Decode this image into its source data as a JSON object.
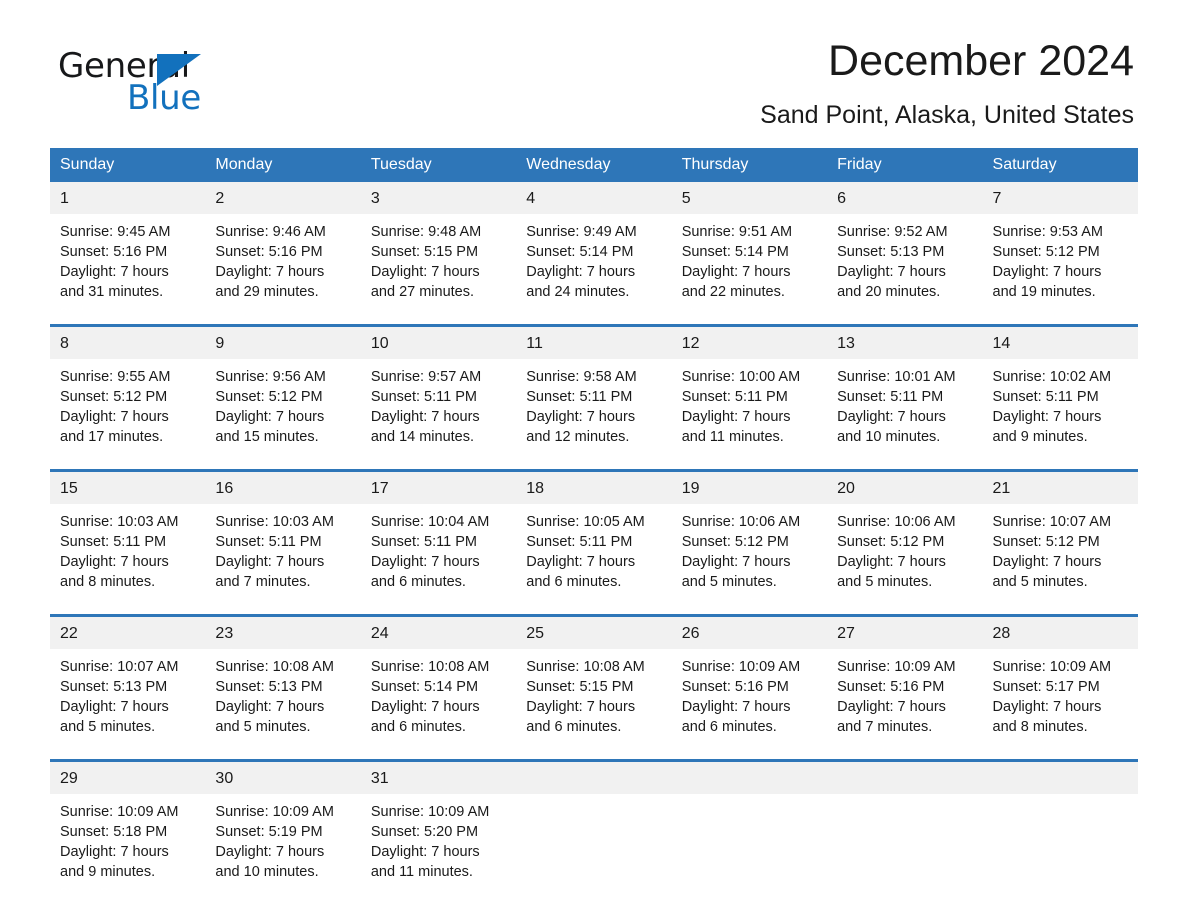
{
  "logo": {
    "word_one": "General",
    "word_two": "Blue",
    "triangle": "triangle-mark"
  },
  "header": {
    "title": "December 2024",
    "location": "Sand Point, Alaska, United States"
  },
  "calendar": {
    "day_headers": [
      "Sunday",
      "Monday",
      "Tuesday",
      "Wednesday",
      "Thursday",
      "Friday",
      "Saturday"
    ],
    "colors": {
      "header_blue": "#2e76b8",
      "daynum_band": "#f1f1f1",
      "logo_blue": "#1271bd",
      "text": "#1a1a1a"
    },
    "weeks": [
      [
        {
          "day": "1",
          "sunrise": "Sunrise: 9:45 AM",
          "sunset": "Sunset: 5:16 PM",
          "daylight1": "Daylight: 7 hours",
          "daylight2": "and 31 minutes."
        },
        {
          "day": "2",
          "sunrise": "Sunrise: 9:46 AM",
          "sunset": "Sunset: 5:16 PM",
          "daylight1": "Daylight: 7 hours",
          "daylight2": "and 29 minutes."
        },
        {
          "day": "3",
          "sunrise": "Sunrise: 9:48 AM",
          "sunset": "Sunset: 5:15 PM",
          "daylight1": "Daylight: 7 hours",
          "daylight2": "and 27 minutes."
        },
        {
          "day": "4",
          "sunrise": "Sunrise: 9:49 AM",
          "sunset": "Sunset: 5:14 PM",
          "daylight1": "Daylight: 7 hours",
          "daylight2": "and 24 minutes."
        },
        {
          "day": "5",
          "sunrise": "Sunrise: 9:51 AM",
          "sunset": "Sunset: 5:14 PM",
          "daylight1": "Daylight: 7 hours",
          "daylight2": "and 22 minutes."
        },
        {
          "day": "6",
          "sunrise": "Sunrise: 9:52 AM",
          "sunset": "Sunset: 5:13 PM",
          "daylight1": "Daylight: 7 hours",
          "daylight2": "and 20 minutes."
        },
        {
          "day": "7",
          "sunrise": "Sunrise: 9:53 AM",
          "sunset": "Sunset: 5:12 PM",
          "daylight1": "Daylight: 7 hours",
          "daylight2": "and 19 minutes."
        }
      ],
      [
        {
          "day": "8",
          "sunrise": "Sunrise: 9:55 AM",
          "sunset": "Sunset: 5:12 PM",
          "daylight1": "Daylight: 7 hours",
          "daylight2": "and 17 minutes."
        },
        {
          "day": "9",
          "sunrise": "Sunrise: 9:56 AM",
          "sunset": "Sunset: 5:12 PM",
          "daylight1": "Daylight: 7 hours",
          "daylight2": "and 15 minutes."
        },
        {
          "day": "10",
          "sunrise": "Sunrise: 9:57 AM",
          "sunset": "Sunset: 5:11 PM",
          "daylight1": "Daylight: 7 hours",
          "daylight2": "and 14 minutes."
        },
        {
          "day": "11",
          "sunrise": "Sunrise: 9:58 AM",
          "sunset": "Sunset: 5:11 PM",
          "daylight1": "Daylight: 7 hours",
          "daylight2": "and 12 minutes."
        },
        {
          "day": "12",
          "sunrise": "Sunrise: 10:00 AM",
          "sunset": "Sunset: 5:11 PM",
          "daylight1": "Daylight: 7 hours",
          "daylight2": "and 11 minutes."
        },
        {
          "day": "13",
          "sunrise": "Sunrise: 10:01 AM",
          "sunset": "Sunset: 5:11 PM",
          "daylight1": "Daylight: 7 hours",
          "daylight2": "and 10 minutes."
        },
        {
          "day": "14",
          "sunrise": "Sunrise: 10:02 AM",
          "sunset": "Sunset: 5:11 PM",
          "daylight1": "Daylight: 7 hours",
          "daylight2": "and 9 minutes."
        }
      ],
      [
        {
          "day": "15",
          "sunrise": "Sunrise: 10:03 AM",
          "sunset": "Sunset: 5:11 PM",
          "daylight1": "Daylight: 7 hours",
          "daylight2": "and 8 minutes."
        },
        {
          "day": "16",
          "sunrise": "Sunrise: 10:03 AM",
          "sunset": "Sunset: 5:11 PM",
          "daylight1": "Daylight: 7 hours",
          "daylight2": "and 7 minutes."
        },
        {
          "day": "17",
          "sunrise": "Sunrise: 10:04 AM",
          "sunset": "Sunset: 5:11 PM",
          "daylight1": "Daylight: 7 hours",
          "daylight2": "and 6 minutes."
        },
        {
          "day": "18",
          "sunrise": "Sunrise: 10:05 AM",
          "sunset": "Sunset: 5:11 PM",
          "daylight1": "Daylight: 7 hours",
          "daylight2": "and 6 minutes."
        },
        {
          "day": "19",
          "sunrise": "Sunrise: 10:06 AM",
          "sunset": "Sunset: 5:12 PM",
          "daylight1": "Daylight: 7 hours",
          "daylight2": "and 5 minutes."
        },
        {
          "day": "20",
          "sunrise": "Sunrise: 10:06 AM",
          "sunset": "Sunset: 5:12 PM",
          "daylight1": "Daylight: 7 hours",
          "daylight2": "and 5 minutes."
        },
        {
          "day": "21",
          "sunrise": "Sunrise: 10:07 AM",
          "sunset": "Sunset: 5:12 PM",
          "daylight1": "Daylight: 7 hours",
          "daylight2": "and 5 minutes."
        }
      ],
      [
        {
          "day": "22",
          "sunrise": "Sunrise: 10:07 AM",
          "sunset": "Sunset: 5:13 PM",
          "daylight1": "Daylight: 7 hours",
          "daylight2": "and 5 minutes."
        },
        {
          "day": "23",
          "sunrise": "Sunrise: 10:08 AM",
          "sunset": "Sunset: 5:13 PM",
          "daylight1": "Daylight: 7 hours",
          "daylight2": "and 5 minutes."
        },
        {
          "day": "24",
          "sunrise": "Sunrise: 10:08 AM",
          "sunset": "Sunset: 5:14 PM",
          "daylight1": "Daylight: 7 hours",
          "daylight2": "and 6 minutes."
        },
        {
          "day": "25",
          "sunrise": "Sunrise: 10:08 AM",
          "sunset": "Sunset: 5:15 PM",
          "daylight1": "Daylight: 7 hours",
          "daylight2": "and 6 minutes."
        },
        {
          "day": "26",
          "sunrise": "Sunrise: 10:09 AM",
          "sunset": "Sunset: 5:16 PM",
          "daylight1": "Daylight: 7 hours",
          "daylight2": "and 6 minutes."
        },
        {
          "day": "27",
          "sunrise": "Sunrise: 10:09 AM",
          "sunset": "Sunset: 5:16 PM",
          "daylight1": "Daylight: 7 hours",
          "daylight2": "and 7 minutes."
        },
        {
          "day": "28",
          "sunrise": "Sunrise: 10:09 AM",
          "sunset": "Sunset: 5:17 PM",
          "daylight1": "Daylight: 7 hours",
          "daylight2": "and 8 minutes."
        }
      ],
      [
        {
          "day": "29",
          "sunrise": "Sunrise: 10:09 AM",
          "sunset": "Sunset: 5:18 PM",
          "daylight1": "Daylight: 7 hours",
          "daylight2": "and 9 minutes."
        },
        {
          "day": "30",
          "sunrise": "Sunrise: 10:09 AM",
          "sunset": "Sunset: 5:19 PM",
          "daylight1": "Daylight: 7 hours",
          "daylight2": "and 10 minutes."
        },
        {
          "day": "31",
          "sunrise": "Sunrise: 10:09 AM",
          "sunset": "Sunset: 5:20 PM",
          "daylight1": "Daylight: 7 hours",
          "daylight2": "and 11 minutes."
        },
        {
          "day": "",
          "sunrise": "",
          "sunset": "",
          "daylight1": "",
          "daylight2": ""
        },
        {
          "day": "",
          "sunrise": "",
          "sunset": "",
          "daylight1": "",
          "daylight2": ""
        },
        {
          "day": "",
          "sunrise": "",
          "sunset": "",
          "daylight1": "",
          "daylight2": ""
        },
        {
          "day": "",
          "sunrise": "",
          "sunset": "",
          "daylight1": "",
          "daylight2": ""
        }
      ]
    ]
  }
}
